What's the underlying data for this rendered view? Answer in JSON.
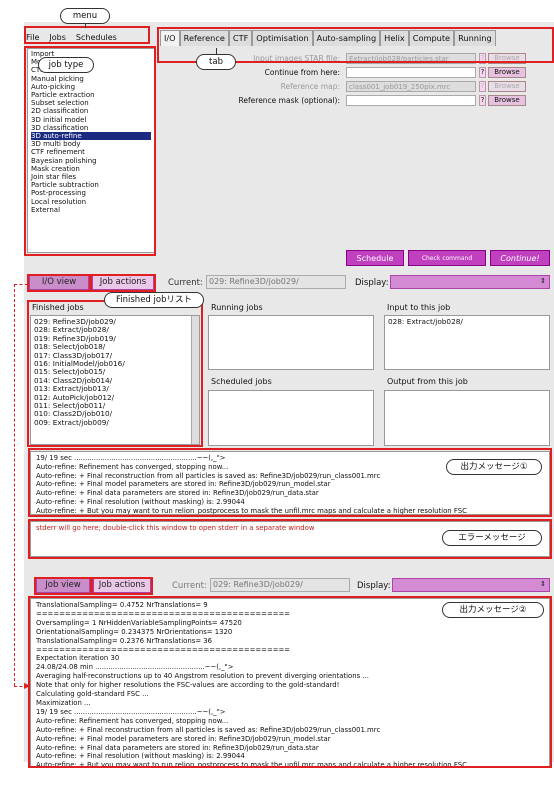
{
  "menu": {
    "items": [
      "File",
      "Jobs",
      "Schedules"
    ]
  },
  "job_types": [
    "Import",
    "Motion correction",
    "CTF estimation",
    "Manual picking",
    "Auto-picking",
    "Particle extraction",
    "Subset selection",
    "2D classification",
    "3D initial model",
    "3D classification",
    "3D auto-refine",
    "3D multi body",
    "CTF refinement",
    "Bayesian polishing",
    "Mask creation",
    "Join star files",
    "Particle subtraction",
    "Post-processing",
    "Local resolution",
    "External"
  ],
  "job_types_selected": "3D auto-refine",
  "tabs": [
    "I/O",
    "Reference",
    "CTF",
    "Optimisation",
    "Auto-sampling",
    "Helix",
    "Compute",
    "Running"
  ],
  "params": [
    {
      "label": "Input images STAR file:",
      "value": "Extract/job028/particles.star",
      "browse": "Browse",
      "help": "?",
      "enabled": false
    },
    {
      "label": "Continue from here:",
      "value": "",
      "browse": "Browse",
      "help": "?",
      "enabled": true
    },
    {
      "label": "Reference map:",
      "value": "class001_job019_250pix.mrc",
      "browse": "Browse",
      "help": "?",
      "enabled": false
    },
    {
      "label": "Reference mask (optional):",
      "value": "",
      "browse": "Browse",
      "help": "?",
      "enabled": true
    }
  ],
  "run_buttons": {
    "schedule": "Schedule",
    "check": "Check command",
    "continue": "Continue!"
  },
  "controls_top": {
    "io_view": "I/O view",
    "job_actions": "Job actions",
    "current_label": "Current:",
    "current_value": "029: Refine3D/job029/",
    "display_label": "Display:"
  },
  "panels": {
    "finished": "Finished jobs",
    "running": "Running jobs",
    "scheduled": "Scheduled jobs",
    "input": "Input to this job",
    "output": "Output from this job"
  },
  "finished_jobs": [
    "029: Refine3D/job029/",
    "028: Extract/job028/",
    "019: Refine3D/job019/",
    "018: Select/job018/",
    "017: Class3D/job017/",
    "016: InitialModel/job016/",
    "015: Select/job015/",
    "014: Class2D/job014/",
    "013: Extract/job013/",
    "012: AutoPick/job012/",
    "011: Select/job011/",
    "010: Class2D/job010/",
    "009: Extract/job009/"
  ],
  "input_jobs": [
    "028: Extract/job028/"
  ],
  "log1": [
    "19/ 19 sec ........................................................~~(,_\">",
    "Auto-refine: Refinement has converged, stopping now...",
    "Auto-refine: + Final reconstruction from all particles is saved as: Refine3D/job029/run_class001.mrc",
    "Auto-refine: + Final model parameters are stored in: Refine3D/job029/run_model.star",
    "Auto-refine: + Final data parameters are stored in: Refine3D/job029/run_data.star",
    "Auto-refine: + Final resolution (without masking) is: 2.99044",
    "Auto-refine: + But you may want to run relion_postprocess to mask the unfil.mrc maps and calculate a higher resolution FSC"
  ],
  "stderr_text": "stderr will go here; double-click this window to open stderr in a separate window",
  "controls_bottom": {
    "job_view": "Job view",
    "job_actions": "Job actions",
    "current_label": "Current:",
    "current_value": "029: Refine3D/job029/",
    "display_label": "Display:"
  },
  "log2": [
    "TranslationalSampling= 0.4752 NrTranslations= 9",
    "============================================",
    "Oversampling= 1 NrHiddenVariableSamplingPoints= 47520",
    "OrientationalSampling= 0.234375 NrOrientations= 1320",
    "TranslationalSampling= 0.2376 NrTranslations= 36",
    "============================================",
    "Expectation iteration 30",
    "24.08/24.08 min ..................................................~~(,_\">",
    "Averaging half-reconstructions up to 40 Angstrom resolution to prevent diverging orientations ...",
    "Note that only for higher resolutions the FSC-values are according to the gold-standard!",
    "Calculating gold-standard FSC ...",
    "Maximization ...",
    "19/ 19 sec ........................................................~~(,_\">",
    "Auto-refine: Refinement has converged, stopping now...",
    "Auto-refine: + Final reconstruction from all particles is saved as: Refine3D/job029/run_class001.mrc",
    "Auto-refine: + Final model parameters are stored in: Refine3D/job029/run_model.star",
    "Auto-refine: + Final data parameters are stored in: Refine3D/job029/run_data.star",
    "Auto-refine: + Final resolution (without masking) is: 2.99044",
    "Auto-refine: + But you may want to run relion_postprocess to mask the unfil.mrc maps and calculate a higher resolution FSC"
  ],
  "annotations": {
    "menu": "menu",
    "job_type": "job type",
    "tab": "tab",
    "finished_list": "Finished jobリスト",
    "out_msg1": "出力メッセージ①",
    "error_msg": "エラーメッセージ",
    "out_msg2": "出力メッセージ②"
  },
  "colors": {
    "accent": "#c040c0",
    "annotation_red": "#e02020",
    "selected": "#1a2a80"
  }
}
